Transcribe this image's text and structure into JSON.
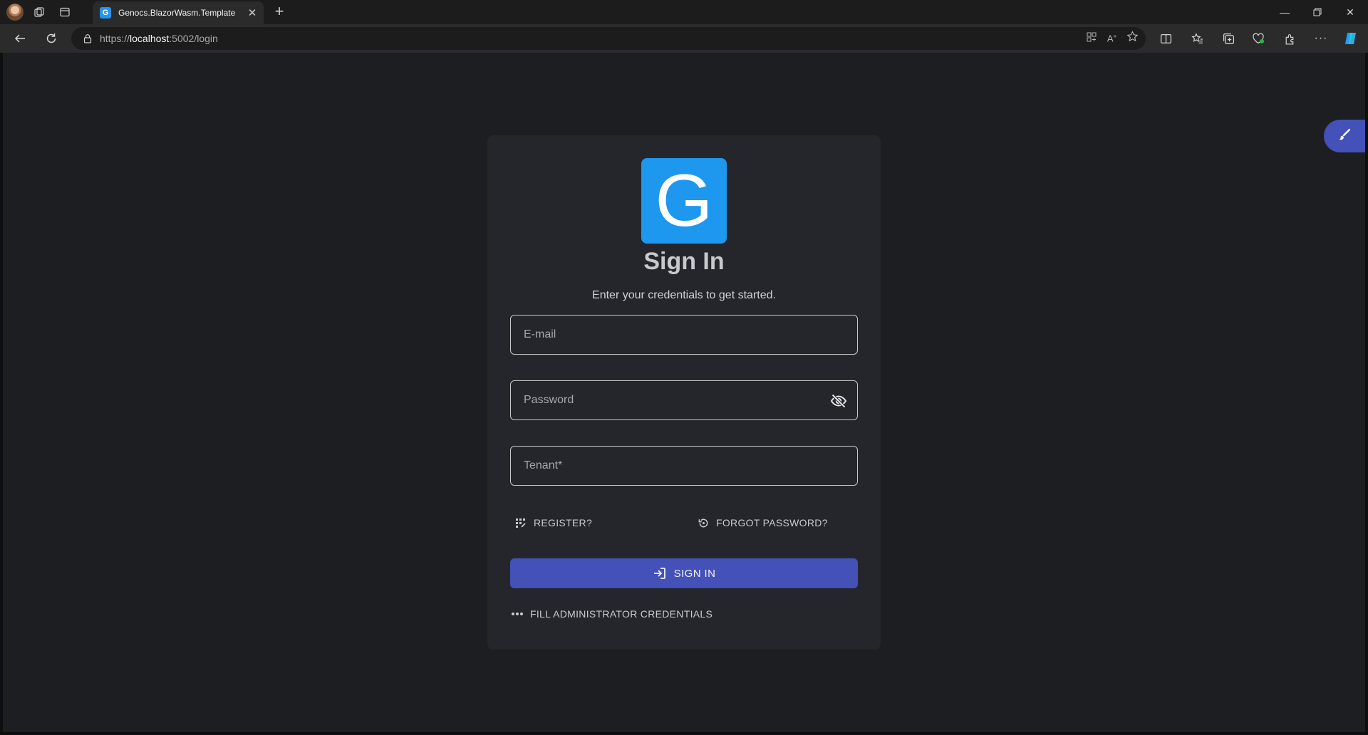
{
  "browser": {
    "tab_title": "Genocs.BlazorWasm.Template",
    "tab_favicon_letter": "G",
    "url_scheme": "https://",
    "url_host": "localhost",
    "url_path": ":5002/login"
  },
  "login": {
    "logo_letter": "G",
    "title": "Sign In",
    "subtitle": "Enter your credentials to get started.",
    "email_placeholder": "E-mail",
    "password_placeholder": "Password",
    "tenant_placeholder": "Tenant*",
    "register_label": "REGISTER?",
    "forgot_label": "FORGOT PASSWORD?",
    "signin_label": "SIGN IN",
    "fill_admin_label": "FILL ADMINISTRATOR CREDENTIALS"
  },
  "colors": {
    "page_bg": "#1c1e21",
    "card_bg": "#24262b",
    "primary": "#4451b8",
    "logo_bg": "#1e98ef"
  },
  "icons": {
    "password_toggle": "eye-off-icon",
    "register": "register-icon",
    "forgot": "restore-icon",
    "signin": "login-icon",
    "fill_admin": "more-horiz-icon",
    "theme": "brush-icon"
  }
}
